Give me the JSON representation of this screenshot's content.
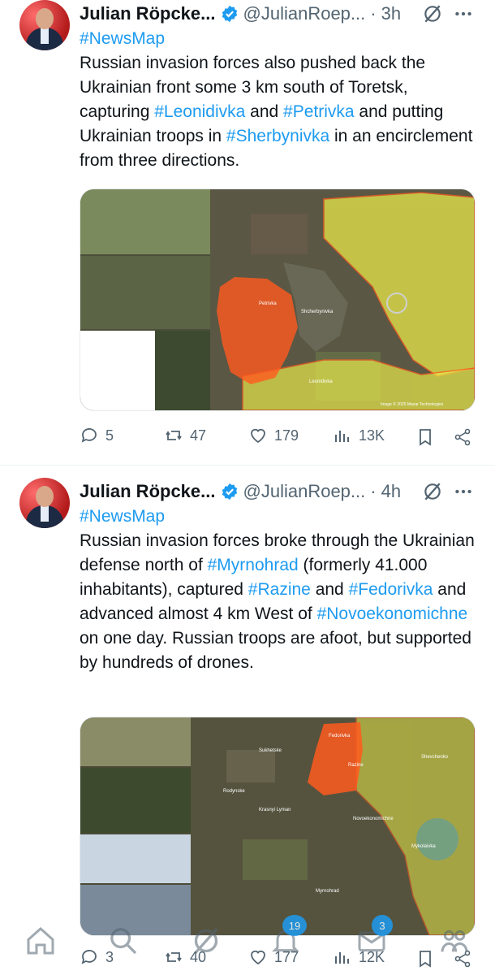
{
  "tweets": [
    {
      "author": "Julian Röpcke...",
      "handle": "@JulianRoep...",
      "time": "3h",
      "text_segments": [
        {
          "t": "#NewsMap",
          "tag": true
        },
        {
          "t": "\nRussian invasion forces also pushed back the Ukrainian front some 3 km south of Toretsk, capturing ",
          "tag": false
        },
        {
          "t": "#Leonidivka",
          "tag": true
        },
        {
          "t": " and ",
          "tag": false
        },
        {
          "t": "#Petrivka",
          "tag": true
        },
        {
          "t": " and putting Ukrainian troops in ",
          "tag": false
        },
        {
          "t": "#Sherbynivka",
          "tag": true
        },
        {
          "t": " in an encirclement from three directions.",
          "tag": false
        }
      ],
      "map_labels": {
        "a": "Petrivka",
        "b": "Shcherbynivka",
        "c": "Leonidivka",
        "credit": "Image © 2025 Maxar Technologies"
      },
      "stats": {
        "replies": "5",
        "reposts": "47",
        "likes": "179",
        "views": "13K"
      }
    },
    {
      "author": "Julian Röpcke...",
      "handle": "@JulianRoep...",
      "time": "4h",
      "text_segments": [
        {
          "t": "#NewsMap",
          "tag": true
        },
        {
          "t": "\nRussian invasion forces broke through the Ukrainian defense north of ",
          "tag": false
        },
        {
          "t": "#Myrnohrad",
          "tag": true
        },
        {
          "t": " (formerly 41.000 inhabitants), captured ",
          "tag": false
        },
        {
          "t": "#Razine",
          "tag": true
        },
        {
          "t": " and ",
          "tag": false
        },
        {
          "t": "#Fedorivka",
          "tag": true
        },
        {
          "t": " and advanced almost 4 km West of ",
          "tag": false
        },
        {
          "t": "#Novoekonomichne",
          "tag": true
        },
        {
          "t": " on one day. Russian troops are afoot, but supported by hundreds of drones.",
          "tag": false
        }
      ],
      "map_labels": {
        "a": "Sukhetske",
        "b": "Fedorivka",
        "c": "Razine",
        "d": "Novoekonomichne",
        "e": "Myrnohrad",
        "f": "Rodynske",
        "g": "Shevchenko",
        "h": "Krasnyi Lyman",
        "i": "Mykolaivka"
      },
      "stats": {
        "replies": "3",
        "reposts": "40",
        "likes": "177",
        "views": "12K"
      }
    }
  ],
  "nav": {
    "notif_badge": "19",
    "messages_badge": "3"
  },
  "colors": {
    "link": "#1d9bf0",
    "muted": "#536471",
    "russian_area": "#ff5a1f",
    "ukrainian_area": "#e8e84a"
  }
}
